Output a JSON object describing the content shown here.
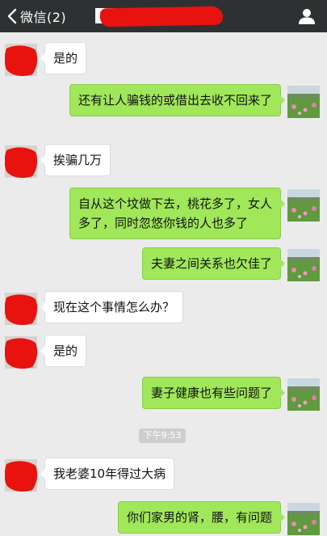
{
  "nav": {
    "back_label": "微信(2)",
    "title": "███████"
  },
  "messages": [
    {
      "side": "left",
      "text": "是的"
    },
    {
      "side": "right",
      "text": "还有让人骗钱的或借出去收不回来了"
    },
    {
      "side": "left",
      "text": "挨骗几万"
    },
    {
      "side": "right",
      "text": "自从这个坟做下去，桃花多了，女人多了，同时忽悠你钱的人也多了"
    },
    {
      "side": "right",
      "text": "夫妻之间关系也欠佳了"
    },
    {
      "side": "left",
      "text": "现在这个事情怎么办？"
    },
    {
      "side": "left",
      "text": "是的"
    },
    {
      "side": "right",
      "text": "妻子健康也有些问题了"
    },
    {
      "side": "left",
      "text": "我老婆10年得过大病"
    },
    {
      "side": "right",
      "text": "你们家男的肾，腰，有问题"
    }
  ],
  "timestamp": "下午9:53",
  "colors": {
    "nav_bg": "#2e3132",
    "chat_bg": "#ebebeb",
    "bubble_right": "#a0e75a",
    "bubble_left": "#ffffff",
    "redaction": "#e8120f"
  },
  "icons": {
    "back": "chevron-left-icon",
    "profile": "person-icon",
    "left_avatar": "redacted-avatar",
    "right_avatar": "lotus-pond-avatar"
  }
}
